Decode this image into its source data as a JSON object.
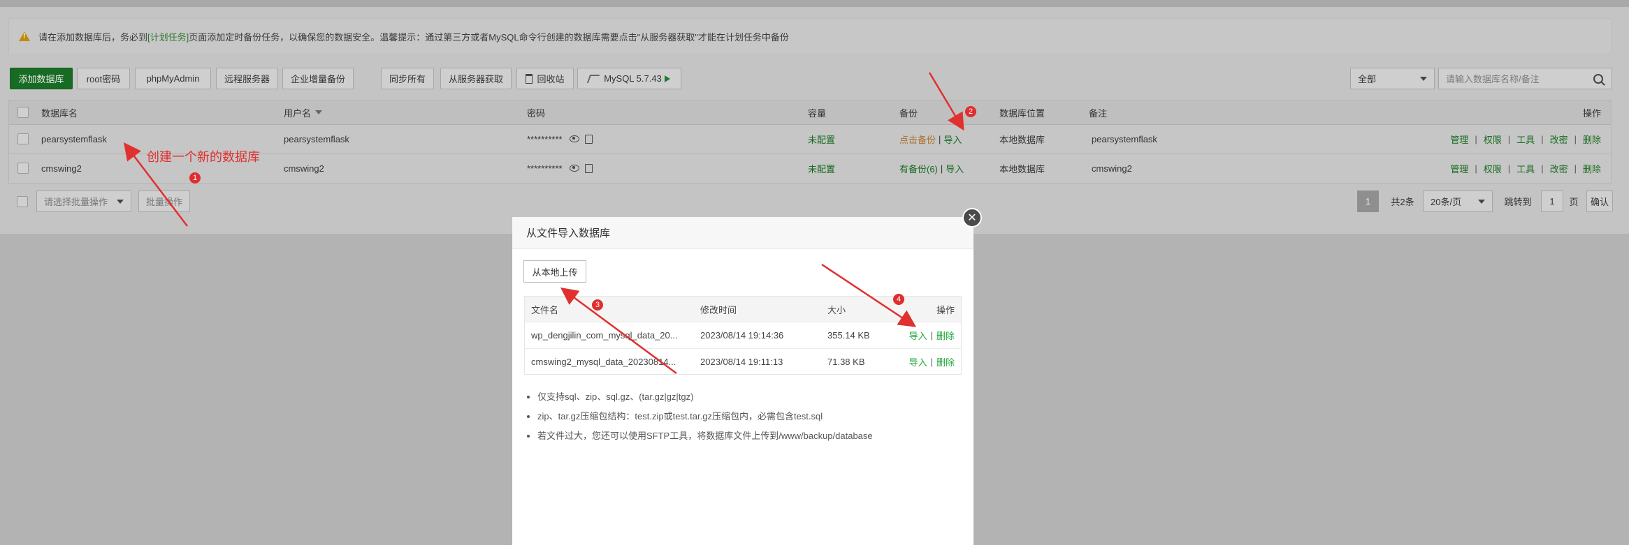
{
  "notice": {
    "prefix": "请在添加数据库后，务必到",
    "link": "[计划任务]",
    "suffix": "页面添加定时备份任务，以确保您的数据安全。温馨提示：通过第三方或者MySQL命令行创建的数据库需要点击\"从服务器获取\"才能在计划任务中备份"
  },
  "toolbar": {
    "add_db": "添加数据库",
    "root_pwd": "root密码",
    "phpmyadmin": "phpMyAdmin",
    "remote": "远程服务器",
    "incremental": "企业增量备份",
    "sync_all": "同步所有",
    "fetch": "从服务器获取",
    "recycle": "回收站",
    "mysql": "MySQL 5.7.43",
    "filter_value": "全部",
    "search_placeholder": "请输入数据库名称/备注"
  },
  "table": {
    "headers": {
      "name": "数据库名",
      "user": "用户名",
      "password": "密码",
      "capacity": "容量",
      "backup": "备份",
      "location": "数据库位置",
      "note": "备注",
      "ops": "操作"
    },
    "rows": [
      {
        "name": "pearsystemflask",
        "user": "pearsystemflask",
        "password": "**********",
        "capacity": "未配置",
        "backup": "点击备份",
        "import": "导入",
        "location": "本地数据库",
        "note": "pearsystemflask"
      },
      {
        "name": "cmswing2",
        "user": "cmswing2",
        "password": "**********",
        "capacity": "未配置",
        "backup": "有备份(6)",
        "import": "导入",
        "location": "本地数据库",
        "note": "cmswing2"
      }
    ],
    "ops": [
      "管理",
      "权限",
      "工具",
      "改密",
      "删除"
    ]
  },
  "footer": {
    "batch_placeholder": "请选择批量操作",
    "batch_button": "批量操作",
    "page": "1",
    "total": "共2条",
    "per_page": "20条/页",
    "jump_label": "跳转到",
    "jump_value": "1",
    "page_unit": "页",
    "confirm": "确认"
  },
  "annotations": {
    "a1_text": "创建一个新的数据库",
    "b1": "1",
    "b2": "2",
    "b3": "3",
    "b4": "4"
  },
  "modal": {
    "title": "从文件导入数据库",
    "upload": "从本地上传",
    "headers": {
      "file": "文件名",
      "mtime": "修改时间",
      "size": "大小",
      "ops": "操作"
    },
    "files": [
      {
        "file": "wp_dengjilin_com_mysql_data_20...",
        "mtime": "2023/08/14 19:14:36",
        "size": "355.14 KB",
        "import": "导入",
        "delete": "删除"
      },
      {
        "file": "cmswing2_mysql_data_20230814...",
        "mtime": "2023/08/14 19:11:13",
        "size": "71.38 KB",
        "import": "导入",
        "delete": "删除"
      }
    ],
    "notes": [
      "仅支持sql、zip、sql.gz、(tar.gz|gz|tgz)",
      "zip、tar.gz压缩包结构：test.zip或test.tar.gz压缩包内，必需包含test.sql",
      "若文件过大，您还可以使用SFTP工具，将数据库文件上传到/www/backup/database"
    ]
  },
  "colors": {
    "accent_green": "#20a53a",
    "annotation_red": "#e03030",
    "overlay_gray": "#b3b3b3"
  }
}
